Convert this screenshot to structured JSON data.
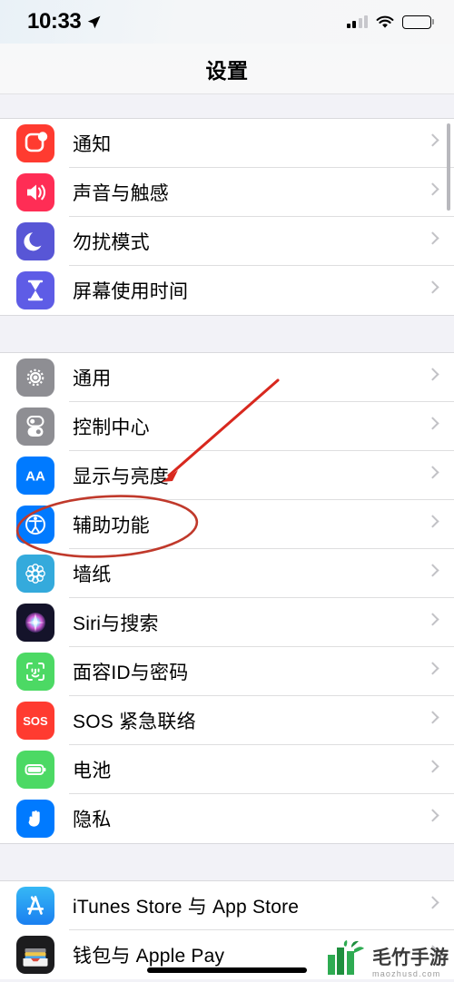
{
  "status_bar": {
    "time": "10:33",
    "location_icon": "location-arrow-icon",
    "signal_icon": "cellular-signal-icon",
    "signal_bars_filled": 2,
    "signal_bars_total": 4,
    "wifi_icon": "wifi-icon",
    "battery_icon": "battery-full-icon",
    "battery_level": 100
  },
  "navbar": {
    "title": "设置"
  },
  "groups": [
    {
      "id": "group-notifications",
      "rows": [
        {
          "label": "通知",
          "icon": "notifications-icon",
          "color": "#FF3B30"
        },
        {
          "label": "声音与触感",
          "icon": "sound-haptics-icon",
          "color": "#FF2D55"
        },
        {
          "label": "勿扰模式",
          "icon": "do-not-disturb-icon",
          "color": "#5856D6"
        },
        {
          "label": "屏幕使用时间",
          "icon": "screen-time-icon",
          "color": "#5E5CE6"
        }
      ]
    },
    {
      "id": "group-system",
      "rows": [
        {
          "label": "通用",
          "icon": "gear-icon",
          "color": "#8E8E93"
        },
        {
          "label": "控制中心",
          "icon": "control-center-icon",
          "color": "#8E8E93"
        },
        {
          "label": "显示与亮度",
          "icon": "display-brightness-icon",
          "color": "#007AFF"
        },
        {
          "label": "辅助功能",
          "icon": "accessibility-icon",
          "color": "#007AFF"
        },
        {
          "label": "墙纸",
          "icon": "wallpaper-icon",
          "color": "#34AADC"
        },
        {
          "label": "Siri与搜索",
          "icon": "siri-icon",
          "color": "#1c1b2e"
        },
        {
          "label": "面容ID与密码",
          "icon": "face-id-icon",
          "color": "#4CD964"
        },
        {
          "label": "SOS 紧急联络",
          "icon": "sos-icon",
          "color": "#FF3B30"
        },
        {
          "label": "电池",
          "icon": "battery-icon",
          "color": "#4CD964"
        },
        {
          "label": "隐私",
          "icon": "privacy-hand-icon",
          "color": "#007AFF"
        }
      ]
    },
    {
      "id": "group-stores",
      "rows": [
        {
          "label": "iTunes Store 与 App Store",
          "icon": "app-store-icon",
          "color": "#1FA2F3"
        },
        {
          "label": "钱包与 Apple Pay",
          "icon": "wallet-icon",
          "color": "#1c1c1e"
        }
      ]
    }
  ],
  "annotations": {
    "color": "#d8281e",
    "ellipse": {
      "target": "辅助功能",
      "shape": "ellipse-highlight"
    },
    "arrow": {
      "target": "辅助功能",
      "shape": "arrow-pointer"
    }
  },
  "watermark": {
    "logo_icon": "bamboo-logo-icon",
    "name": "毛竹手游",
    "url": "maozhusd.com"
  },
  "home_indicator": {
    "name": "home-indicator"
  }
}
